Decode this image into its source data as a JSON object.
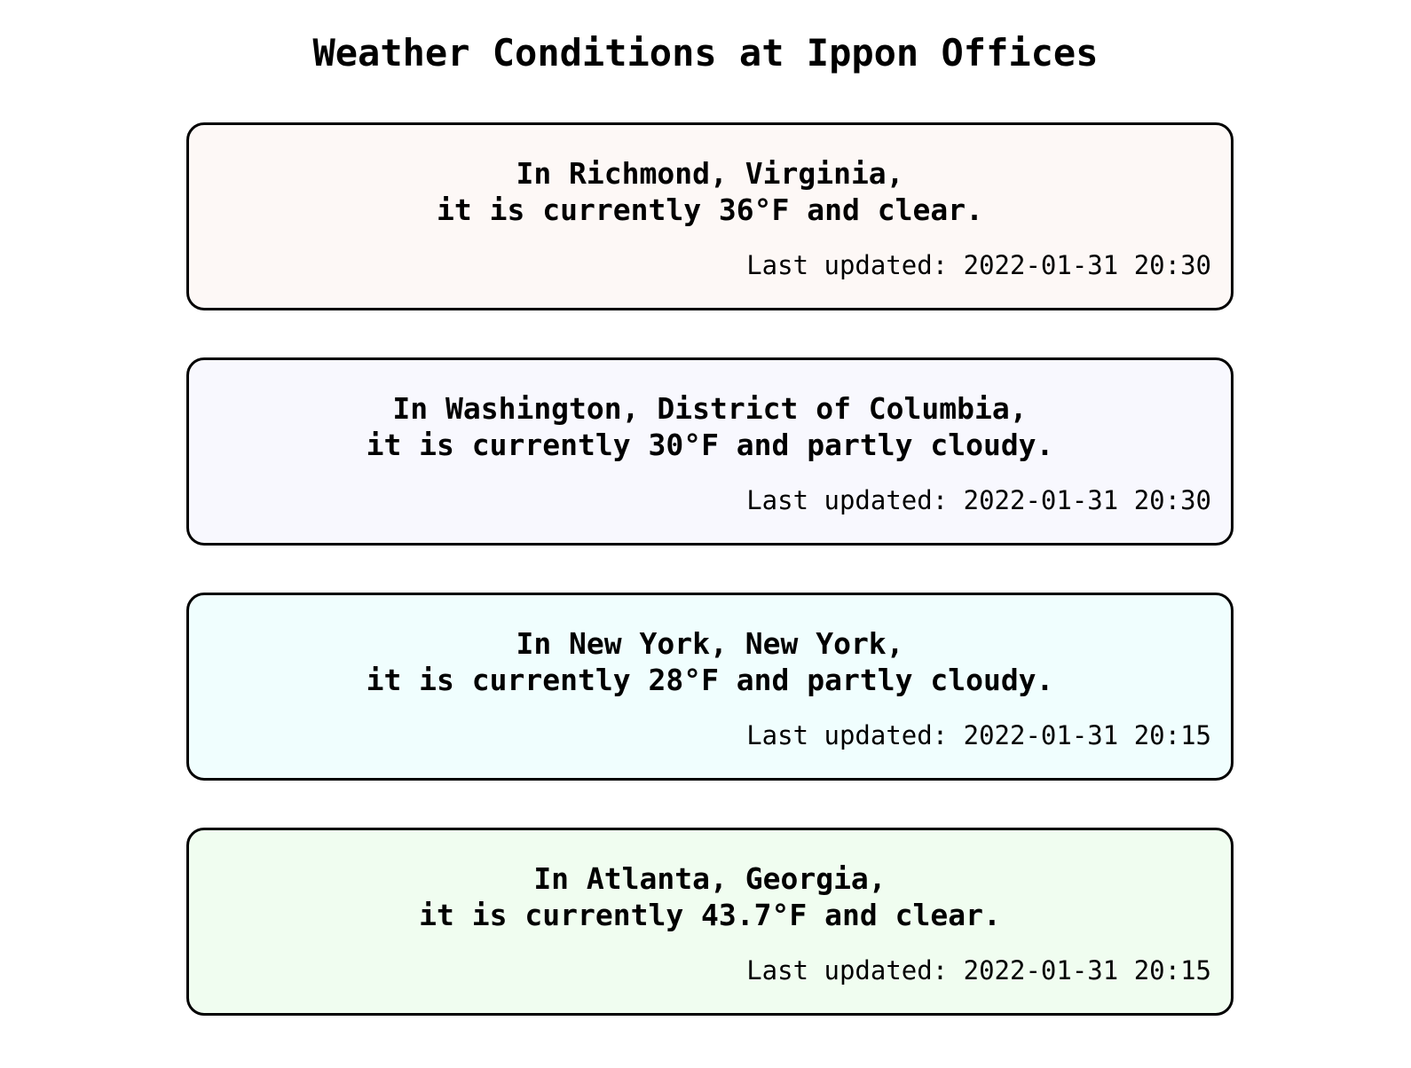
{
  "page": {
    "title": "Weather Conditions at Ippon Offices"
  },
  "cards": [
    {
      "location_line": "In Richmond, Virginia,",
      "condition_line": "it is currently 36°F and clear.",
      "updated": "Last updated: 2022-01-31 20:30",
      "background": "#fdf8f6"
    },
    {
      "location_line": "In Washington, District of Columbia,",
      "condition_line": "it is currently 30°F and partly cloudy.",
      "updated": "Last updated: 2022-01-31 20:30",
      "background": "#f8f8fe"
    },
    {
      "location_line": "In New York, New York,",
      "condition_line": "it is currently 28°F and partly cloudy.",
      "updated": "Last updated: 2022-01-31 20:15",
      "background": "#f0fefe"
    },
    {
      "location_line": "In Atlanta, Georgia,",
      "condition_line": "it is currently 43.7°F and clear.",
      "updated": "Last updated: 2022-01-31 20:15",
      "background": "#f0fdf0"
    }
  ]
}
